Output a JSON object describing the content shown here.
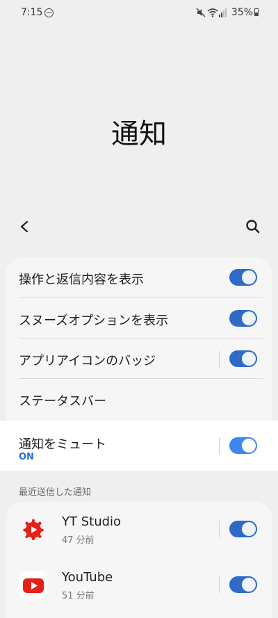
{
  "status_bar": {
    "time": "7:15",
    "battery": "35%",
    "icons": [
      "do-not-disturb-icon",
      "mute-icon",
      "wifi-icon",
      "signal-icon",
      "battery-icon"
    ]
  },
  "header": {
    "title": "通知",
    "back_icon": "back-arrow-icon",
    "search_icon": "search-icon"
  },
  "settings": {
    "items": [
      {
        "label": "操作と返信内容を表示",
        "toggle": true
      },
      {
        "label": "スヌーズオプションを表示",
        "toggle": true
      },
      {
        "label": "アプリアイコンのバッジ",
        "toggle": true
      },
      {
        "label": "ステータスバー"
      }
    ],
    "mute": {
      "label": "通知をミュート",
      "status": "ON",
      "toggle": true
    }
  },
  "recent": {
    "title": "最近送信した通知",
    "apps": [
      {
        "name": "YT Studio",
        "time": "47 分前",
        "icon": "yt-studio-icon",
        "toggle": true
      },
      {
        "name": "YouTube",
        "time": "51 分前",
        "icon": "youtube-icon",
        "toggle": true
      }
    ]
  },
  "colors": {
    "toggle_on": "#2e6ac6",
    "accent": "#1f6fd8",
    "youtube_red": "#e62117"
  }
}
